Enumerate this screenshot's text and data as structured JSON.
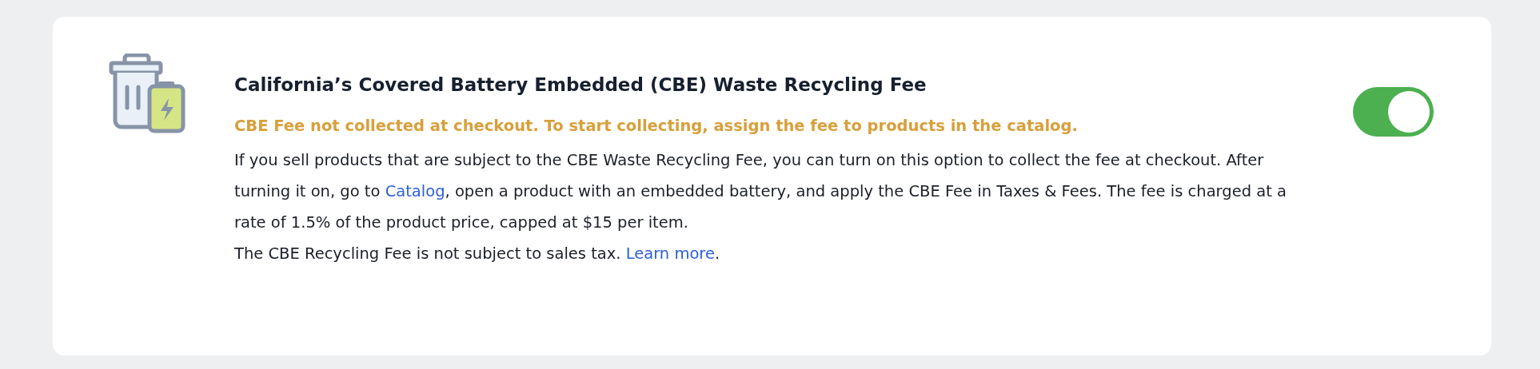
{
  "setting": {
    "title": "California’s Covered Battery Embedded (CBE) Waste Recycling Fee",
    "warning": "CBE Fee not collected at checkout. To start collecting, assign the fee to products in the catalog.",
    "paragraphs": [
      {
        "before": "If you sell products that are subject to the CBE Waste Recycling Fee, you can turn on this option to collect the fee at checkout. After turning it on, go to ",
        "link": "Catalog",
        "after": ", open a product with an embedded battery, and apply the CBE Fee in Taxes & Fees. The fee is charged at a rate of 1.5% of the product price, capped at $15 per item."
      },
      {
        "before": "The CBE Recycling Fee is not subject to sales tax. ",
        "link": "Learn more",
        "after": "."
      }
    ],
    "toggle": {
      "on": true
    }
  }
}
